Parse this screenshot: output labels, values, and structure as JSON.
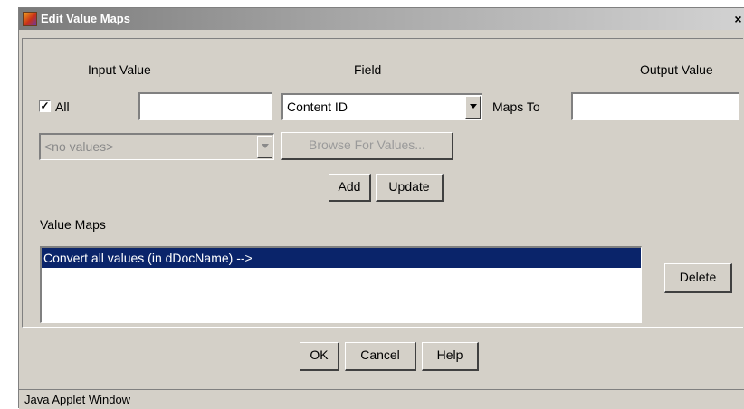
{
  "window": {
    "title": "Edit Value Maps",
    "close_glyph": "×"
  },
  "headers": {
    "input_value": "Input Value",
    "field": "Field",
    "output_value": "Output Value"
  },
  "input": {
    "all_checkbox_label": "All",
    "all_checked": true,
    "check_glyph": "✓",
    "input_value": "",
    "values_combo": "<no values>"
  },
  "field_select": {
    "selected": "Content ID"
  },
  "output": {
    "maps_to_label": "Maps To",
    "output_value": ""
  },
  "buttons": {
    "browse": "Browse For Values...",
    "add": "Add",
    "update": "Update",
    "delete": "Delete",
    "ok": "OK",
    "cancel": "Cancel",
    "help": "Help"
  },
  "value_maps": {
    "label": "Value Maps",
    "items": [
      {
        "text": "Convert all values (in dDocName)  -->",
        "selected": true
      }
    ]
  },
  "status": {
    "text": "Java Applet Window"
  },
  "colors": {
    "dialog_bg": "#d4d0c8",
    "selection": "#0a246a"
  }
}
